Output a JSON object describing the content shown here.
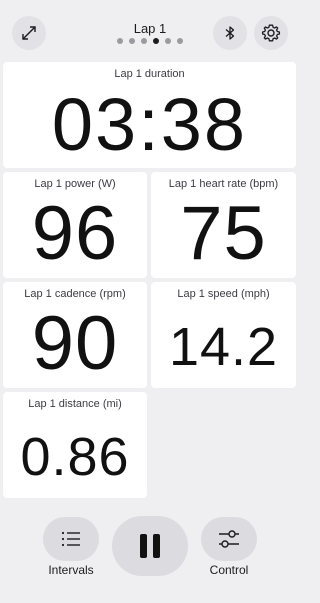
{
  "header": {
    "title": "Lap 1",
    "page_count": 6,
    "active_page_index": 3,
    "icons": {
      "expand": "expand-icon",
      "bluetooth": "bluetooth-icon",
      "settings": "gear-icon"
    }
  },
  "metrics": {
    "duration": {
      "label": "Lap 1 duration",
      "value": "03:38"
    },
    "power": {
      "label": "Lap 1 power (W)",
      "value": "96"
    },
    "heart_rate": {
      "label": "Lap 1 heart rate (bpm)",
      "value": "75"
    },
    "cadence": {
      "label": "Lap 1 cadence (rpm)",
      "value": "90"
    },
    "speed": {
      "label": "Lap 1 speed (mph)",
      "value": "14.2"
    },
    "distance": {
      "label": "Lap 1 distance (mi)",
      "value": "0.86"
    }
  },
  "controls": {
    "intervals_label": "Intervals",
    "control_label": "Control",
    "icons": {
      "intervals": "list-icon",
      "pause": "pause-icon",
      "control": "sliders-icon"
    }
  },
  "colors": {
    "background": "#efeff2",
    "card": "#ffffff",
    "button": "#dcdce0",
    "text": "#1c1c1e"
  }
}
